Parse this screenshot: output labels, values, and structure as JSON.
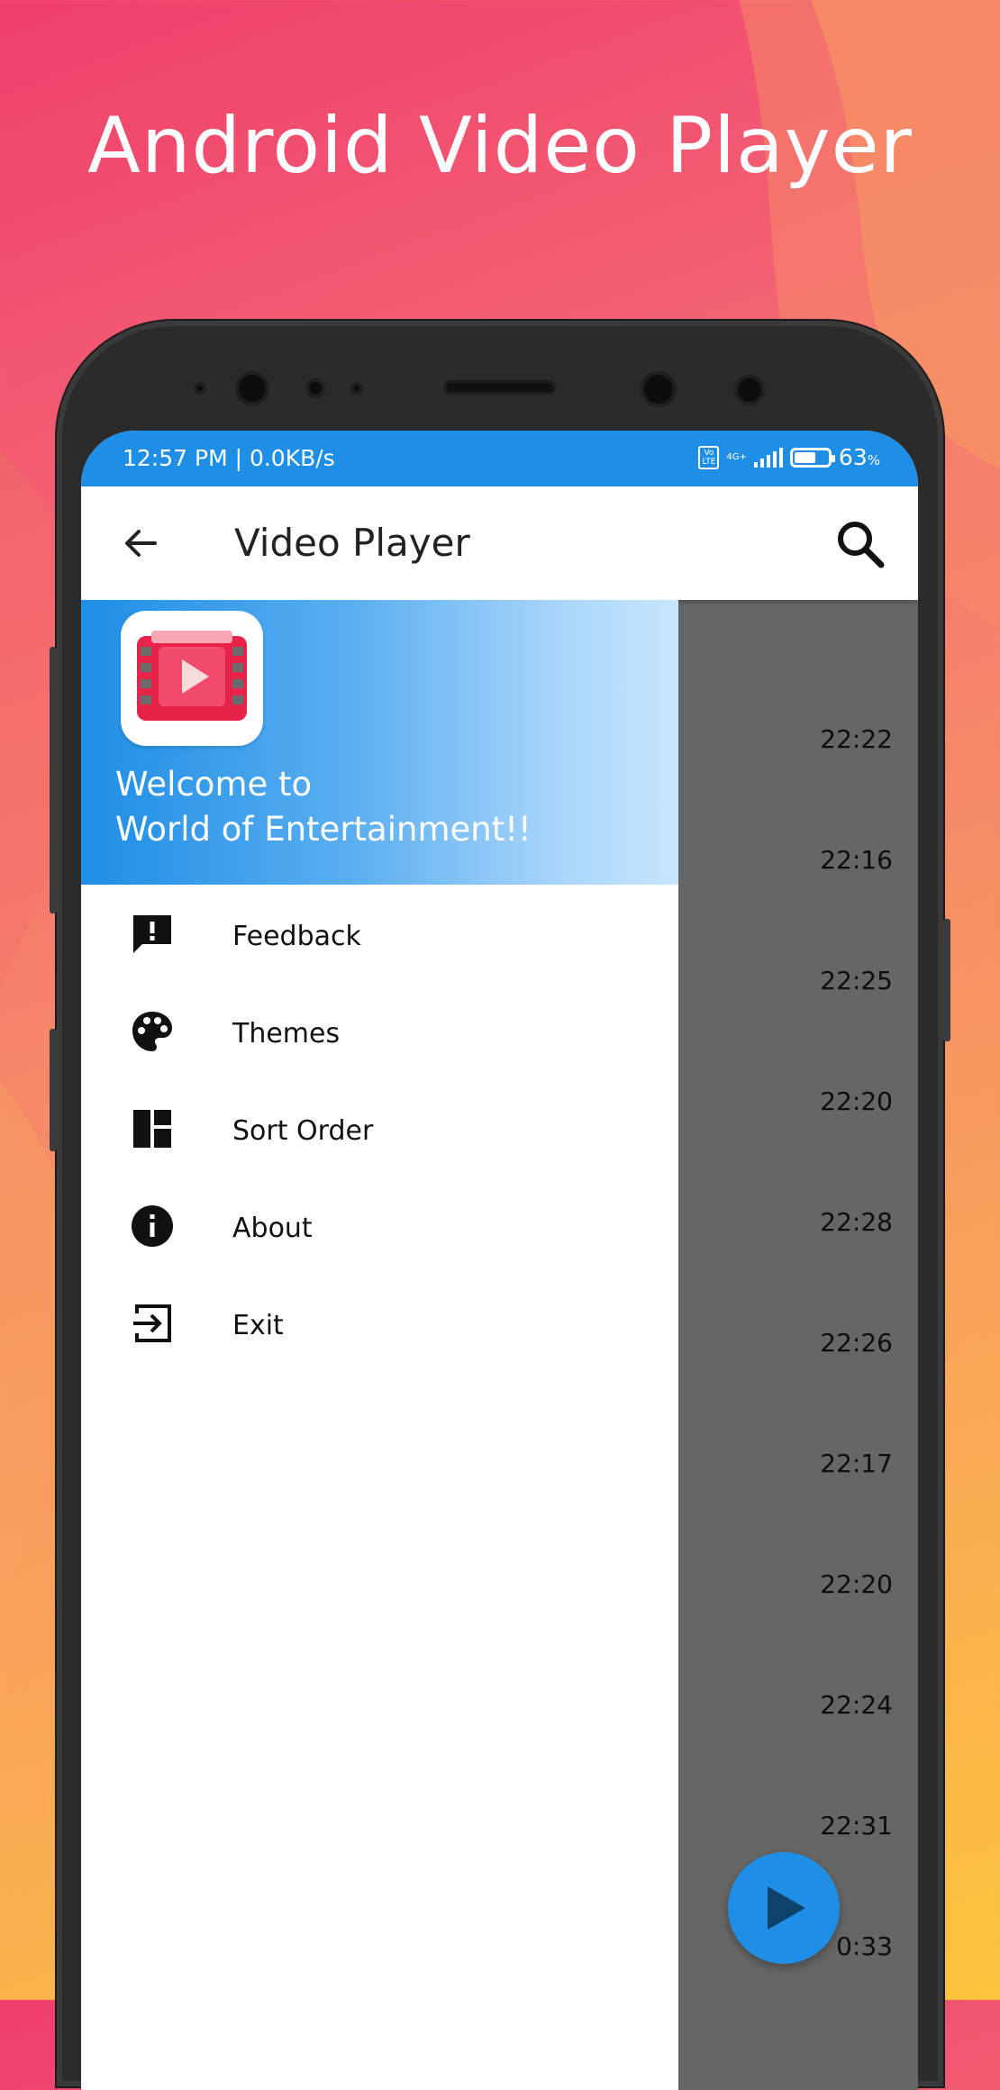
{
  "promo": {
    "title": "Android Video Player"
  },
  "status_bar": {
    "time_speed": "12:57 PM | 0.0KB/s",
    "volte_label": "Vo\nLTE",
    "network_label": "4G+",
    "battery_percent": "63",
    "battery_unit": "%",
    "battery_level": 0.63
  },
  "app_bar": {
    "title": "Video Player"
  },
  "drawer": {
    "welcome_line1": "Welcome to",
    "welcome_line2": "World of Entertainment!!",
    "items": [
      {
        "label": "Feedback",
        "icon": "feedback-icon"
      },
      {
        "label": "Themes",
        "icon": "palette-icon"
      },
      {
        "label": "Sort Order",
        "icon": "dashboard-icon"
      },
      {
        "label": "About",
        "icon": "info-icon"
      },
      {
        "label": "Exit",
        "icon": "exit-icon"
      }
    ]
  },
  "video_list": {
    "durations": [
      "22:22",
      "22:16",
      "22:25",
      "22:20",
      "22:28",
      "22:26",
      "22:17",
      "22:20",
      "22:24",
      "22:31",
      "0:33"
    ]
  },
  "colors": {
    "accent": "#1e8ee6",
    "logo_red": "#e8234a"
  }
}
